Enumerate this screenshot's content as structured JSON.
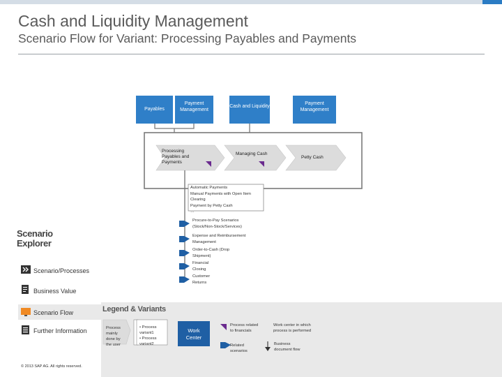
{
  "header": {
    "title": "Cash and Liquidity Management",
    "subtitle": "Scenario Flow for Variant: Processing Payables and Payments"
  },
  "colors": {
    "swimlane_blue": "#2f7fc8",
    "process_grey": "#dcdcdc",
    "accent_purple": "#6a2a8e",
    "work_center_blue": "#1f5fa4",
    "nav_highlight": "#e9e9e9",
    "orange_icon": "#f08a24"
  },
  "swimlanes": [
    {
      "label": "Payables"
    },
    {
      "label": "Payment Management"
    },
    {
      "label": "Cash and Liquidity"
    },
    {
      "label": "Payment Management"
    }
  ],
  "process_steps": [
    {
      "label": "Processing Payables and Payments"
    },
    {
      "label": "Managing Cash"
    },
    {
      "label": "Petty Cash"
    }
  ],
  "scenario_box": {
    "lines": [
      "Automatic Payments",
      "Manual Payments with Open Item",
      "Clearing",
      "Payment by Petty Cash",
      "…"
    ]
  },
  "related_scenarios": [
    {
      "lines": [
        "Procure-to-Pay Scenarios",
        "(Stock/Non-Stock/Services)"
      ]
    },
    {
      "lines": [
        "Expense and Reimbursement",
        "Management"
      ]
    },
    {
      "lines": [
        "Order-to-Cash (Drop",
        "Shipment)"
      ]
    },
    {
      "lines": [
        "Financial",
        "Closing"
      ]
    },
    {
      "lines": [
        "Customer",
        "Returns"
      ]
    }
  ],
  "sidebar": {
    "explorer_title_1": "Scenario",
    "explorer_title_2": "Explorer",
    "items": [
      {
        "label": "Scenario/Processes"
      },
      {
        "label": "Business Value"
      },
      {
        "label": "Scenario Flow"
      },
      {
        "label": "Further Information"
      }
    ]
  },
  "legend": {
    "title": "Legend & Variants",
    "process_mainly": [
      "Process",
      "mainly",
      "done by",
      "the user"
    ],
    "variant_lines": [
      "• Process",
      "variant1",
      "• Process",
      "variant2"
    ],
    "work_center": [
      "Work",
      "Center"
    ],
    "process_related": [
      "Process related",
      "to financials"
    ],
    "work_center_desc": [
      "Work center in which",
      "process is performed"
    ],
    "related_scenarios": [
      "Related",
      "scenarios"
    ],
    "business_flow": [
      "Business",
      "document flow"
    ]
  },
  "footer": {
    "copyright": "© 2013 SAP AG. All rights reserved."
  }
}
